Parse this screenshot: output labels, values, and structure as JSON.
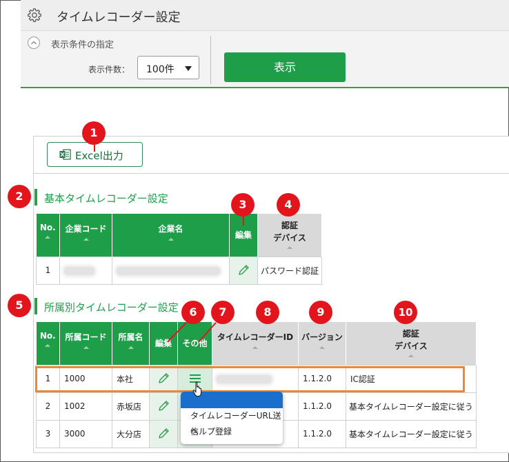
{
  "header": {
    "title": "タイムレコーダー設定"
  },
  "filter": {
    "title": "表示条件の指定",
    "count_label": "表示件数：",
    "count_value": "100件",
    "show_button": "表示"
  },
  "toolbar": {
    "excel_button": "Excel出力"
  },
  "basic": {
    "section_title": "基本タイムレコーダー設定",
    "columns": [
      "No.",
      "企業コード",
      "企業名",
      "編集",
      "認証",
      "デバイス"
    ],
    "rows": [
      {
        "no": "1",
        "device": "パスワード認証"
      }
    ]
  },
  "branch": {
    "section_title": "所属別タイムレコーダー設定",
    "columns": [
      "No.",
      "所属コード",
      "所属名",
      "編集",
      "その他",
      "タイムレコーダーID",
      "バージョン",
      "認証",
      "デバイス"
    ],
    "rows": [
      {
        "no": "1",
        "code": "1000",
        "name": "本社",
        "version": "1.1.2.0",
        "device": "IC認証"
      },
      {
        "no": "2",
        "code": "1002",
        "name": "赤坂店",
        "version": "1.1.2.0",
        "device": "基本タイムレコーダー設定に従う"
      },
      {
        "no": "3",
        "code": "3000",
        "name": "大分店",
        "version": "1.1.2.0",
        "device": "基本タイムレコーダー設定に従う"
      }
    ]
  },
  "menu": {
    "items": [
      "タイムレコーダーURL送信",
      "ヘルプ登録"
    ]
  },
  "badges": [
    "1",
    "2",
    "3",
    "4",
    "5",
    "6",
    "7",
    "8",
    "9",
    "10"
  ],
  "colors": {
    "accent": "#1f9e4a",
    "badge": "#e2151d",
    "highlight": "#e8883a",
    "menu_head": "#1a6fcc"
  }
}
